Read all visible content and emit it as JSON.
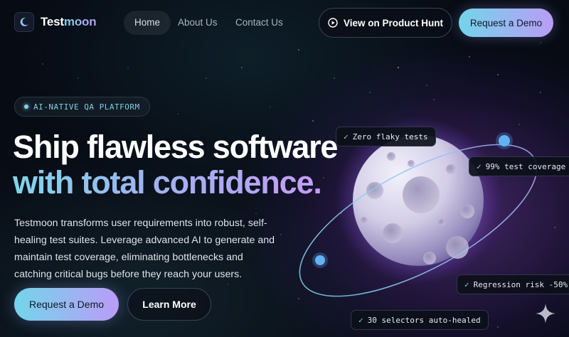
{
  "brand": {
    "name_part1": "Test",
    "name_part2": "moon",
    "icon": "crescent-moon-icon"
  },
  "nav": {
    "links": [
      {
        "label": "Home",
        "active": true
      },
      {
        "label": "About Us",
        "active": false
      },
      {
        "label": "Contact Us",
        "active": false
      }
    ],
    "product_hunt_label": "View on Product Hunt",
    "product_hunt_icon": "play-circle-icon",
    "demo_label": "Request a Demo"
  },
  "hero": {
    "badge": "AI-NATIVE QA PLATFORM",
    "title_line1": "Ship flawless software",
    "title_line2": "with total confidence.",
    "description": "Testmoon transforms user requirements into robust, self-healing test suites. Leverage advanced AI to generate and maintain test coverage, eliminating bottlenecks and catching critical bugs before they reach your users.",
    "cta_primary": "Request a Demo",
    "cta_secondary": "Learn More"
  },
  "orbit_tags": [
    {
      "check": "✓",
      "text": "Zero flaky tests"
    },
    {
      "check": "✓",
      "text": "99% test coverage"
    },
    {
      "check": "✓",
      "text": "Regression risk -50%"
    },
    {
      "check": "✓",
      "text": "30 selectors auto-healed"
    }
  ],
  "colors": {
    "accent_cyan": "#73d5ea",
    "accent_violet": "#ba9cf6",
    "background": "#070b14",
    "check_green": "#7fe0b0"
  }
}
